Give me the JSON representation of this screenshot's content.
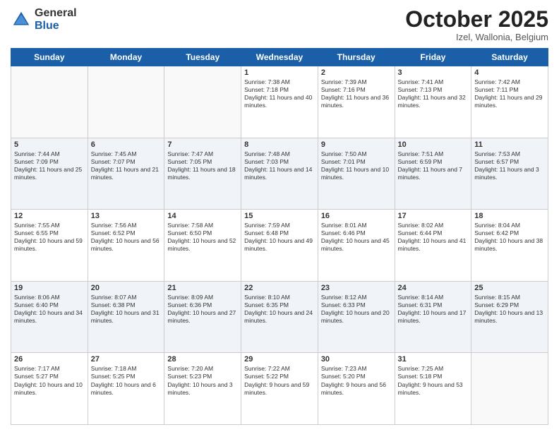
{
  "logo": {
    "general": "General",
    "blue": "Blue"
  },
  "header": {
    "month": "October 2025",
    "location": "Izel, Wallonia, Belgium"
  },
  "weekdays": [
    "Sunday",
    "Monday",
    "Tuesday",
    "Wednesday",
    "Thursday",
    "Friday",
    "Saturday"
  ],
  "weeks": [
    [
      {
        "day": "",
        "sunrise": "",
        "sunset": "",
        "daylight": ""
      },
      {
        "day": "",
        "sunrise": "",
        "sunset": "",
        "daylight": ""
      },
      {
        "day": "",
        "sunrise": "",
        "sunset": "",
        "daylight": ""
      },
      {
        "day": "1",
        "sunrise": "Sunrise: 7:38 AM",
        "sunset": "Sunset: 7:18 PM",
        "daylight": "Daylight: 11 hours and 40 minutes."
      },
      {
        "day": "2",
        "sunrise": "Sunrise: 7:39 AM",
        "sunset": "Sunset: 7:16 PM",
        "daylight": "Daylight: 11 hours and 36 minutes."
      },
      {
        "day": "3",
        "sunrise": "Sunrise: 7:41 AM",
        "sunset": "Sunset: 7:13 PM",
        "daylight": "Daylight: 11 hours and 32 minutes."
      },
      {
        "day": "4",
        "sunrise": "Sunrise: 7:42 AM",
        "sunset": "Sunset: 7:11 PM",
        "daylight": "Daylight: 11 hours and 29 minutes."
      }
    ],
    [
      {
        "day": "5",
        "sunrise": "Sunrise: 7:44 AM",
        "sunset": "Sunset: 7:09 PM",
        "daylight": "Daylight: 11 hours and 25 minutes."
      },
      {
        "day": "6",
        "sunrise": "Sunrise: 7:45 AM",
        "sunset": "Sunset: 7:07 PM",
        "daylight": "Daylight: 11 hours and 21 minutes."
      },
      {
        "day": "7",
        "sunrise": "Sunrise: 7:47 AM",
        "sunset": "Sunset: 7:05 PM",
        "daylight": "Daylight: 11 hours and 18 minutes."
      },
      {
        "day": "8",
        "sunrise": "Sunrise: 7:48 AM",
        "sunset": "Sunset: 7:03 PM",
        "daylight": "Daylight: 11 hours and 14 minutes."
      },
      {
        "day": "9",
        "sunrise": "Sunrise: 7:50 AM",
        "sunset": "Sunset: 7:01 PM",
        "daylight": "Daylight: 11 hours and 10 minutes."
      },
      {
        "day": "10",
        "sunrise": "Sunrise: 7:51 AM",
        "sunset": "Sunset: 6:59 PM",
        "daylight": "Daylight: 11 hours and 7 minutes."
      },
      {
        "day": "11",
        "sunrise": "Sunrise: 7:53 AM",
        "sunset": "Sunset: 6:57 PM",
        "daylight": "Daylight: 11 hours and 3 minutes."
      }
    ],
    [
      {
        "day": "12",
        "sunrise": "Sunrise: 7:55 AM",
        "sunset": "Sunset: 6:55 PM",
        "daylight": "Daylight: 10 hours and 59 minutes."
      },
      {
        "day": "13",
        "sunrise": "Sunrise: 7:56 AM",
        "sunset": "Sunset: 6:52 PM",
        "daylight": "Daylight: 10 hours and 56 minutes."
      },
      {
        "day": "14",
        "sunrise": "Sunrise: 7:58 AM",
        "sunset": "Sunset: 6:50 PM",
        "daylight": "Daylight: 10 hours and 52 minutes."
      },
      {
        "day": "15",
        "sunrise": "Sunrise: 7:59 AM",
        "sunset": "Sunset: 6:48 PM",
        "daylight": "Daylight: 10 hours and 49 minutes."
      },
      {
        "day": "16",
        "sunrise": "Sunrise: 8:01 AM",
        "sunset": "Sunset: 6:46 PM",
        "daylight": "Daylight: 10 hours and 45 minutes."
      },
      {
        "day": "17",
        "sunrise": "Sunrise: 8:02 AM",
        "sunset": "Sunset: 6:44 PM",
        "daylight": "Daylight: 10 hours and 41 minutes."
      },
      {
        "day": "18",
        "sunrise": "Sunrise: 8:04 AM",
        "sunset": "Sunset: 6:42 PM",
        "daylight": "Daylight: 10 hours and 38 minutes."
      }
    ],
    [
      {
        "day": "19",
        "sunrise": "Sunrise: 8:06 AM",
        "sunset": "Sunset: 6:40 PM",
        "daylight": "Daylight: 10 hours and 34 minutes."
      },
      {
        "day": "20",
        "sunrise": "Sunrise: 8:07 AM",
        "sunset": "Sunset: 6:38 PM",
        "daylight": "Daylight: 10 hours and 31 minutes."
      },
      {
        "day": "21",
        "sunrise": "Sunrise: 8:09 AM",
        "sunset": "Sunset: 6:36 PM",
        "daylight": "Daylight: 10 hours and 27 minutes."
      },
      {
        "day": "22",
        "sunrise": "Sunrise: 8:10 AM",
        "sunset": "Sunset: 6:35 PM",
        "daylight": "Daylight: 10 hours and 24 minutes."
      },
      {
        "day": "23",
        "sunrise": "Sunrise: 8:12 AM",
        "sunset": "Sunset: 6:33 PM",
        "daylight": "Daylight: 10 hours and 20 minutes."
      },
      {
        "day": "24",
        "sunrise": "Sunrise: 8:14 AM",
        "sunset": "Sunset: 6:31 PM",
        "daylight": "Daylight: 10 hours and 17 minutes."
      },
      {
        "day": "25",
        "sunrise": "Sunrise: 8:15 AM",
        "sunset": "Sunset: 6:29 PM",
        "daylight": "Daylight: 10 hours and 13 minutes."
      }
    ],
    [
      {
        "day": "26",
        "sunrise": "Sunrise: 7:17 AM",
        "sunset": "Sunset: 5:27 PM",
        "daylight": "Daylight: 10 hours and 10 minutes."
      },
      {
        "day": "27",
        "sunrise": "Sunrise: 7:18 AM",
        "sunset": "Sunset: 5:25 PM",
        "daylight": "Daylight: 10 hours and 6 minutes."
      },
      {
        "day": "28",
        "sunrise": "Sunrise: 7:20 AM",
        "sunset": "Sunset: 5:23 PM",
        "daylight": "Daylight: 10 hours and 3 minutes."
      },
      {
        "day": "29",
        "sunrise": "Sunrise: 7:22 AM",
        "sunset": "Sunset: 5:22 PM",
        "daylight": "Daylight: 9 hours and 59 minutes."
      },
      {
        "day": "30",
        "sunrise": "Sunrise: 7:23 AM",
        "sunset": "Sunset: 5:20 PM",
        "daylight": "Daylight: 9 hours and 56 minutes."
      },
      {
        "day": "31",
        "sunrise": "Sunrise: 7:25 AM",
        "sunset": "Sunset: 5:18 PM",
        "daylight": "Daylight: 9 hours and 53 minutes."
      },
      {
        "day": "",
        "sunrise": "",
        "sunset": "",
        "daylight": ""
      }
    ]
  ]
}
